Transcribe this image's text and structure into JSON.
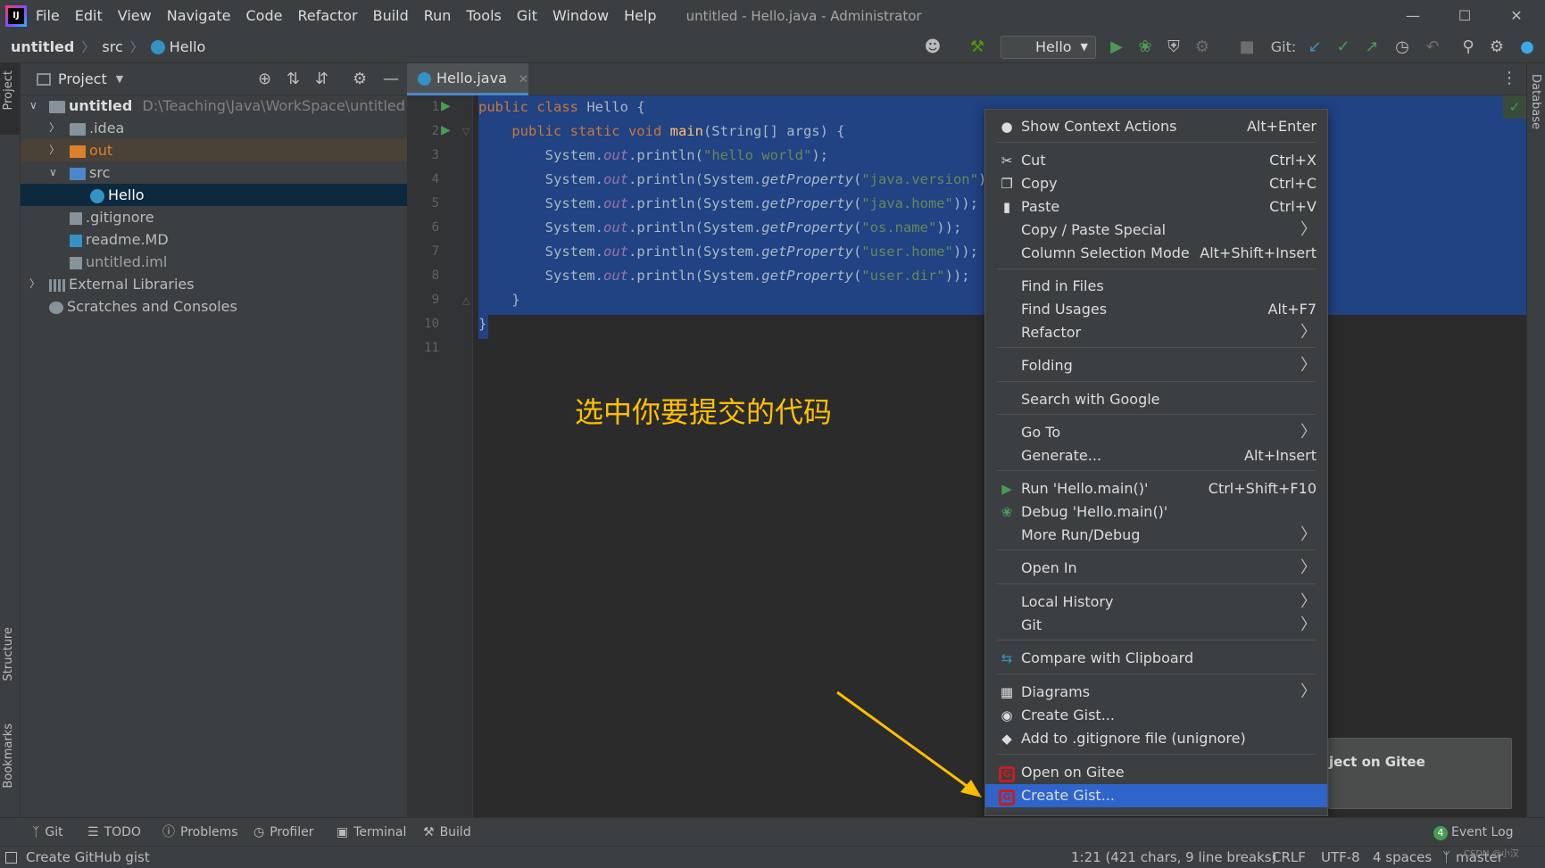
{
  "menubar": {
    "items": [
      "File",
      "Edit",
      "View",
      "Navigate",
      "Code",
      "Refactor",
      "Build",
      "Run",
      "Tools",
      "Git",
      "Window",
      "Help"
    ],
    "window_title": "untitled - Hello.java - Administrator"
  },
  "navbar": {
    "crumbs": [
      "untitled",
      "src",
      "Hello"
    ],
    "run_config": "Hello",
    "git_label": "Git:"
  },
  "project_panel": {
    "title": "Project",
    "tree": [
      {
        "label": "untitled",
        "path": "D:\\Teaching\\Java\\WorkSpace\\untitled"
      },
      {
        "label": ".idea"
      },
      {
        "label": "out"
      },
      {
        "label": "src"
      },
      {
        "label": "Hello"
      },
      {
        "label": ".gitignore"
      },
      {
        "label": "readme.MD"
      },
      {
        "label": "untitled.iml"
      },
      {
        "label": "External Libraries"
      },
      {
        "label": "Scratches and Consoles"
      }
    ]
  },
  "left_strip": {
    "project": "Project",
    "structure": "Structure",
    "bookmarks": "Bookmarks"
  },
  "right_strip": {
    "database": "Database"
  },
  "editor": {
    "tab_label": "Hello.java",
    "line_numbers": [
      "1",
      "2",
      "3",
      "4",
      "5",
      "6",
      "7",
      "8",
      "9",
      "10",
      "11"
    ]
  },
  "annotation_text": "选中你要提交的代码",
  "context_menu": {
    "items": [
      {
        "label": "Show Context Actions",
        "shortcut": "Alt+Enter"
      },
      {
        "label": "Cut",
        "shortcut": "Ctrl+X"
      },
      {
        "label": "Copy",
        "shortcut": "Ctrl+C"
      },
      {
        "label": "Paste",
        "shortcut": "Ctrl+V"
      },
      {
        "label": "Copy / Paste Special",
        "shortcut": ""
      },
      {
        "label": "Column Selection Mode",
        "shortcut": "Alt+Shift+Insert"
      },
      {
        "label": "Find in Files",
        "shortcut": ""
      },
      {
        "label": "Find Usages",
        "shortcut": "Alt+F7"
      },
      {
        "label": "Refactor",
        "shortcut": ""
      },
      {
        "label": "Folding",
        "shortcut": ""
      },
      {
        "label": "Search with Google",
        "shortcut": ""
      },
      {
        "label": "Go To",
        "shortcut": ""
      },
      {
        "label": "Generate...",
        "shortcut": "Alt+Insert"
      },
      {
        "label": "Run 'Hello.main()'",
        "shortcut": "Ctrl+Shift+F10"
      },
      {
        "label": "Debug 'Hello.main()'",
        "shortcut": ""
      },
      {
        "label": "More Run/Debug",
        "shortcut": ""
      },
      {
        "label": "Open In",
        "shortcut": ""
      },
      {
        "label": "Local History",
        "shortcut": ""
      },
      {
        "label": "Git",
        "shortcut": ""
      },
      {
        "label": "Compare with Clipboard",
        "shortcut": ""
      },
      {
        "label": "Diagrams",
        "shortcut": ""
      },
      {
        "label": "Create Gist...",
        "shortcut": ""
      },
      {
        "label": "Add to .gitignore file (unignore)",
        "shortcut": ""
      },
      {
        "label": "Open on Gitee",
        "shortcut": ""
      },
      {
        "label": "Create Gist...",
        "shortcut": ""
      }
    ]
  },
  "notification": {
    "text": "ject on Gitee"
  },
  "toolwindow_bar": {
    "items": [
      "Git",
      "TODO",
      "Problems",
      "Profiler",
      "Terminal",
      "Build"
    ],
    "event_log_count": "4",
    "event_log": "Event Log"
  },
  "status_bar": {
    "message": "Create GitHub gist",
    "position": "1:21 (421 chars, 9 line breaks)",
    "line_sep": "CRLF",
    "encoding": "UTF-8",
    "indent": "4 spaces",
    "branch": "master",
    "watermark": "CSDN @小汉"
  }
}
